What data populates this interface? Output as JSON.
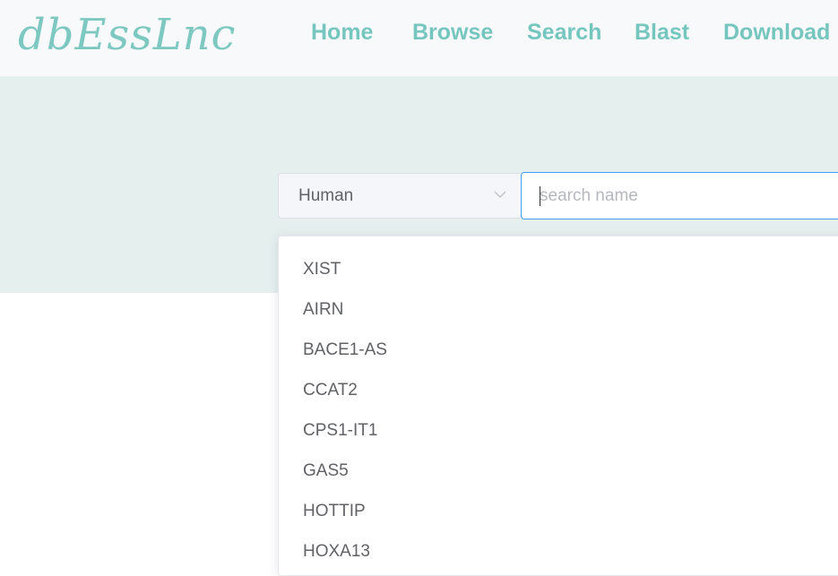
{
  "brand": {
    "logo_text": "dbEssLnc",
    "accent_color": "#76c6c0"
  },
  "nav": {
    "items": [
      {
        "label": "Home"
      },
      {
        "label": "Browse"
      },
      {
        "label": "Search"
      },
      {
        "label": "Blast"
      },
      {
        "label": "Download"
      }
    ]
  },
  "search": {
    "species_selected": "Human",
    "placeholder": "search name",
    "value": ""
  },
  "dropdown": {
    "items": [
      "XIST",
      "AIRN",
      "BACE1-AS",
      "CCAT2",
      "CPS1-IT1",
      "GAS5",
      "HOTTIP",
      "HOXA13"
    ]
  },
  "icons": {
    "select_arrow": "chevron-down-icon"
  }
}
